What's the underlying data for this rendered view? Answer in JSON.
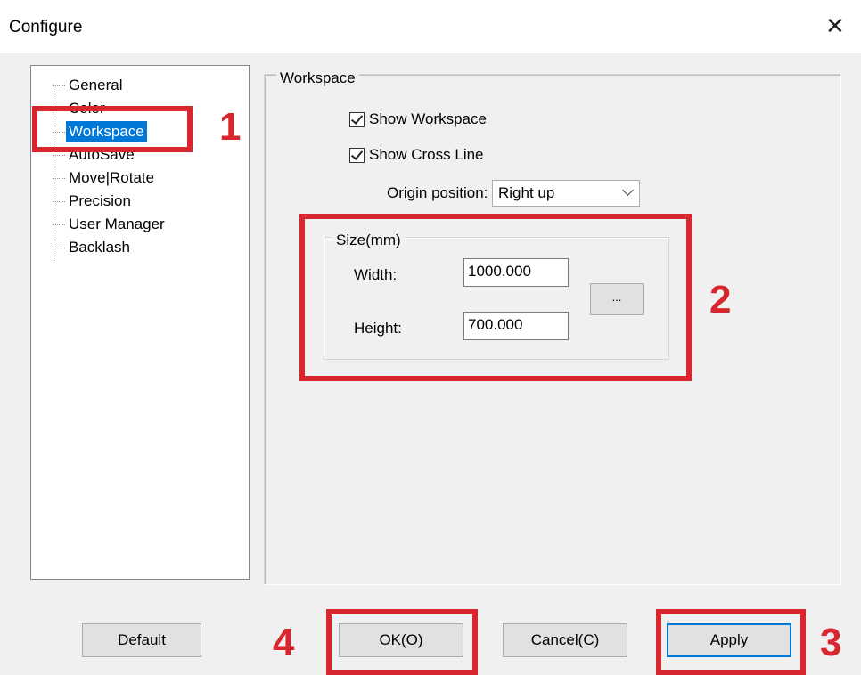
{
  "window": {
    "title": "Configure",
    "close_glyph": "✕"
  },
  "tree": {
    "items": [
      {
        "label": "General",
        "selected": false
      },
      {
        "label": "Color",
        "selected": false
      },
      {
        "label": "Workspace",
        "selected": true
      },
      {
        "label": "AutoSave",
        "selected": false
      },
      {
        "label": "Move|Rotate",
        "selected": false
      },
      {
        "label": "Precision",
        "selected": false
      },
      {
        "label": "User Manager",
        "selected": false
      },
      {
        "label": "Backlash",
        "selected": false
      }
    ]
  },
  "workspace": {
    "group_label": "Workspace",
    "show_workspace": {
      "label": "Show Workspace",
      "checked": true
    },
    "show_cross_line": {
      "label": "Show Cross Line",
      "checked": true
    },
    "origin": {
      "label": "Origin position:",
      "value": "Right up"
    },
    "size": {
      "group_label": "Size(mm)",
      "width_label": "Width:",
      "width_value": "1000.000",
      "height_label": "Height:",
      "height_value": "700.000",
      "browse_label": "..."
    }
  },
  "buttons": {
    "default_label": "Default",
    "ok_label": "OK(O)",
    "cancel_label": "Cancel(C)",
    "apply_label": "Apply"
  },
  "annotations": {
    "step1": "1",
    "step2": "2",
    "step3": "3",
    "step4": "4",
    "color": "#d8262f"
  }
}
